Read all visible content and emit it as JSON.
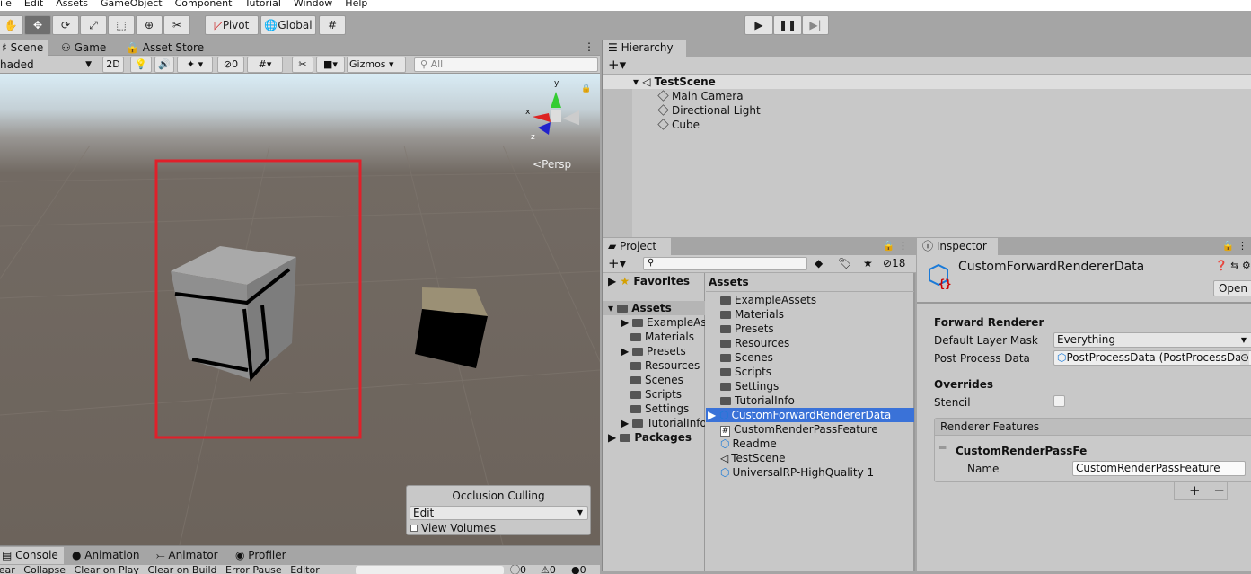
{
  "menu": [
    "ile",
    "Edit",
    "Assets",
    "GameObject",
    "Component",
    "Tutorial",
    "Window",
    "Help"
  ],
  "toolbar": {
    "pivot": "Pivot",
    "global": "Global",
    "play_icon": "play-icon",
    "pause_icon": "pause-icon",
    "step_icon": "step-icon"
  },
  "scene": {
    "tabs": [
      "Scene",
      "Game",
      "Asset Store"
    ],
    "shading": "haded",
    "mode_2d": "2D",
    "hidden_count": "0",
    "gizmos": "Gizmos",
    "search_placeholder": "All",
    "persp": "Persp",
    "gizmo_axes": {
      "x": "x",
      "y": "y",
      "z": "z"
    }
  },
  "occlusion": {
    "title": "Occlusion Culling",
    "mode": "Edit",
    "view_volumes": "View Volumes"
  },
  "console": {
    "tabs": [
      "Console",
      "Animation",
      "Animator",
      "Profiler"
    ],
    "buttons": [
      "Clear",
      "Collapse",
      "Clear on Play",
      "Clear on Build",
      "Error Pause",
      "Editor"
    ],
    "counts": [
      "0",
      "0",
      "0"
    ]
  },
  "hierarchy": {
    "title": "Hierarchy",
    "scene": "TestScene",
    "items": [
      "Main Camera",
      "Directional Light",
      "Cube"
    ]
  },
  "project": {
    "title": "Project",
    "hidden_count": "18",
    "favorites": "Favorites",
    "assets": "Assets",
    "packages": "Packages",
    "tree": [
      "ExampleAss",
      "Materials",
      "Presets",
      "Resources",
      "Scenes",
      "Scripts",
      "Settings",
      "TutorialInfo"
    ],
    "header": "Assets",
    "list": [
      {
        "name": "ExampleAssets",
        "icon": "folder"
      },
      {
        "name": "Materials",
        "icon": "folder"
      },
      {
        "name": "Presets",
        "icon": "folder"
      },
      {
        "name": "Resources",
        "icon": "folder"
      },
      {
        "name": "Scenes",
        "icon": "folder"
      },
      {
        "name": "Scripts",
        "icon": "folder"
      },
      {
        "name": "Settings",
        "icon": "folder"
      },
      {
        "name": "TutorialInfo",
        "icon": "folder"
      },
      {
        "name": "CustomForwardRendererData",
        "icon": "asset",
        "selected": true
      },
      {
        "name": "CustomRenderPassFeature",
        "icon": "script"
      },
      {
        "name": "Readme",
        "icon": "asset"
      },
      {
        "name": "TestScene",
        "icon": "scene"
      },
      {
        "name": "UniversalRP-HighQuality 1",
        "icon": "asset"
      }
    ]
  },
  "inspector": {
    "title": "Inspector",
    "object": "CustomForwardRendererData",
    "open": "Open",
    "section1": "Forward Renderer",
    "layer_mask_label": "Default Layer Mask",
    "layer_mask": "Everything",
    "ppd_label": "Post Process Data",
    "ppd": "PostProcessData (PostProcessDa",
    "overrides": "Overrides",
    "stencil": "Stencil",
    "features_title": "Renderer Features",
    "feature": "CustomRenderPassFe",
    "name_label": "Name",
    "name_value": "CustomRenderPassFeature",
    "add": "+",
    "remove": "−"
  },
  "colors": {
    "selection": "#3a72d8",
    "highlight_box": "#e0202a"
  }
}
